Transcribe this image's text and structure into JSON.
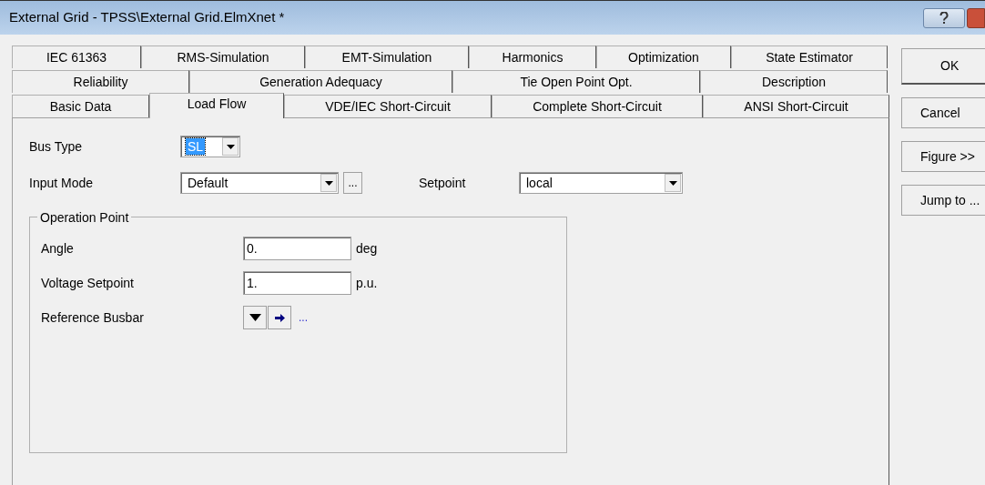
{
  "window": {
    "title": "External Grid - TPSS\\External Grid.ElmXnet *"
  },
  "tab_rows": [
    [
      {
        "label": "IEC 61363",
        "selected": false
      },
      {
        "label": "RMS-Simulation",
        "selected": false
      },
      {
        "label": "EMT-Simulation",
        "selected": false
      },
      {
        "label": "Harmonics",
        "selected": false
      },
      {
        "label": "Optimization",
        "selected": false
      },
      {
        "label": "State Estimator",
        "selected": false
      }
    ],
    [
      {
        "label": "Reliability",
        "selected": false
      },
      {
        "label": "Generation Adequacy",
        "selected": false
      },
      {
        "label": "Tie Open Point Opt.",
        "selected": false
      },
      {
        "label": "Description",
        "selected": false
      }
    ],
    [
      {
        "label": "Basic Data",
        "selected": false
      },
      {
        "label": "Load Flow",
        "selected": true
      },
      {
        "label": "VDE/IEC Short-Circuit",
        "selected": false
      },
      {
        "label": "Complete Short-Circuit",
        "selected": false
      },
      {
        "label": "ANSI Short-Circuit",
        "selected": false
      }
    ]
  ],
  "bus_type": {
    "label": "Bus Type",
    "value": "SL"
  },
  "input_mode": {
    "label": "Input Mode",
    "value": "Default",
    "more": "..."
  },
  "setpoint": {
    "label": "Setpoint",
    "value": "local"
  },
  "operation_point": {
    "title": "Operation Point",
    "angle": {
      "label": "Angle",
      "value": "0.",
      "unit": "deg"
    },
    "voltage_setpoint": {
      "label": "Voltage Setpoint",
      "value": "1.",
      "unit": "p.u."
    },
    "reference_busbar": {
      "label": "Reference Busbar",
      "more": "..."
    }
  },
  "buttons": [
    "OK",
    "Cancel",
    "Figure >>",
    "Jump to ..."
  ]
}
